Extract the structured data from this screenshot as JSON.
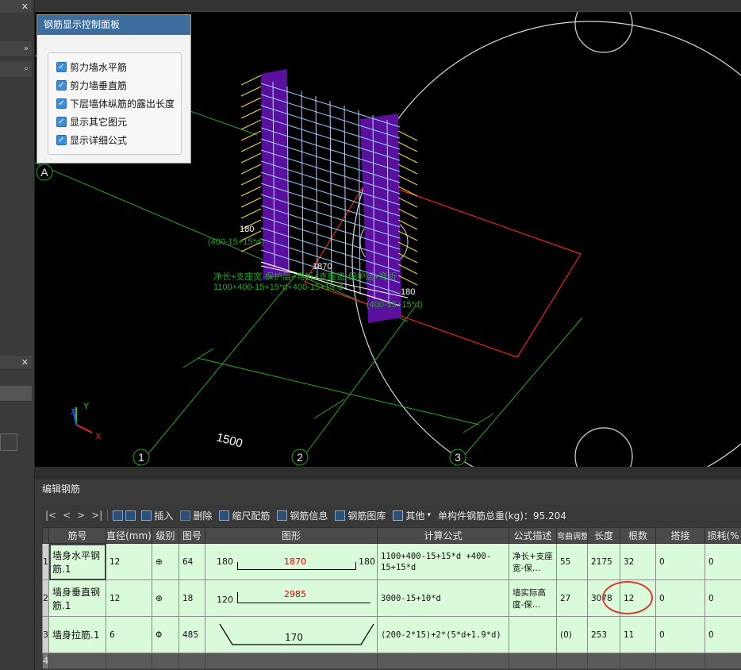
{
  "control_panel": {
    "title": "钢筋显示控制面板",
    "options": [
      {
        "label": "剪力墙水平筋",
        "checked": true
      },
      {
        "label": "剪力墙垂直筋",
        "checked": true
      },
      {
        "label": "下层墙体纵筋的露出长度",
        "checked": true
      },
      {
        "label": "显示其它图元",
        "checked": true
      },
      {
        "label": "显示详细公式",
        "checked": true
      }
    ]
  },
  "viewport": {
    "axis_labels": {
      "a": "A",
      "one": "1",
      "two": "2",
      "three": "3"
    },
    "dim_1500": "1500",
    "dim_180_top": "180",
    "dim_1870": "1870",
    "dim_180_right": "180",
    "formula_text_1": "(400-15+15*d)",
    "formula_text_2": "净长+支座宽-保护层+弯折+支座宽-保护层+弯折",
    "formula_text_3": "1100+400-15+15*d+400-15+15*d",
    "formula_text_4": "(400-15+15*d)",
    "ucs": {
      "x": "X",
      "y": "Y",
      "z": "Z"
    }
  },
  "edit_panel": {
    "title": "编辑钢筋",
    "toolbar": {
      "nav": [
        "|<",
        "<",
        ">",
        ">|"
      ],
      "insert": "插入",
      "delete": "删除",
      "scale": "缩尺配筋",
      "info": "钢筋信息",
      "library": "钢筋图库",
      "other": "其他",
      "total_weight_label": "单构件钢筋总重(kg)：95.204"
    },
    "columns": [
      "筋号",
      "直径(mm)",
      "级别",
      "图号",
      "图形",
      "计算公式",
      "公式描述",
      "弯曲调整",
      "长度",
      "根数",
      "搭接",
      "损耗(%"
    ],
    "rows": [
      {
        "num": "1",
        "name": "墙身水平钢筋.1",
        "dia": "12",
        "grade": "⊕",
        "fig": "64",
        "shape_left": "180",
        "shape_mid": "1870",
        "shape_right": "180",
        "formula": "1100+400-15+15*d +400-15+15*d",
        "desc": "净长+支座宽-保…",
        "bend": "55",
        "length": "2175",
        "count": "32",
        "lap": "0",
        "loss": "0"
      },
      {
        "num": "2",
        "name": "墙身垂直钢筋.1",
        "dia": "12",
        "grade": "⊕",
        "fig": "18",
        "shape_left": "120",
        "shape_mid": "2985",
        "shape_right": "",
        "formula": "3000-15+10*d",
        "desc": "墙实际高度-保…",
        "bend": "27",
        "length": "3078",
        "count": "12",
        "lap": "0",
        "loss": "0"
      },
      {
        "num": "3",
        "name": "墙身拉筋.1",
        "dia": "6",
        "grade": "Φ",
        "fig": "485",
        "shape_left": "",
        "shape_mid": "170",
        "shape_right": "",
        "formula": "(200-2*15)+2*(5*d+1.9*d)",
        "desc": "",
        "bend": "(0)",
        "length": "253",
        "count": "11",
        "lap": "0",
        "loss": "0"
      }
    ],
    "empty_row_num": "4"
  },
  "colors": {
    "accent": "#3d6e9e",
    "row_bg": "#d9fbd9",
    "highlight": "#d63a3a"
  }
}
